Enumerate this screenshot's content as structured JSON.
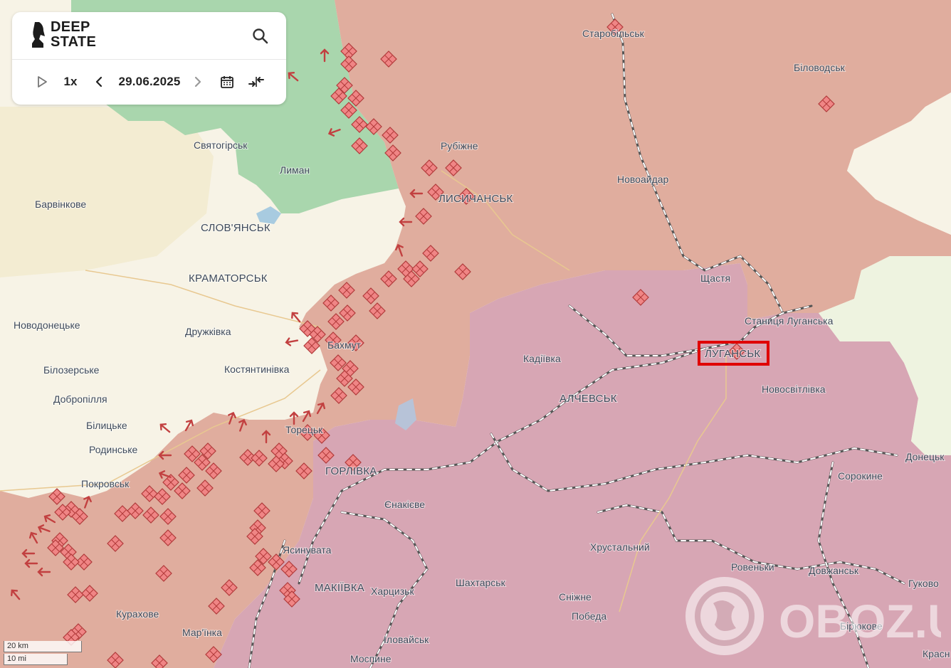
{
  "app": {
    "logo_line1": "DEEP",
    "logo_line2": "STATE",
    "speed": "1x",
    "date": "29.06.2025"
  },
  "icons": [
    "deepstate-knight-icon",
    "search-icon",
    "play-icon",
    "chevron-left-icon",
    "chevron-right-icon",
    "calendar-icon",
    "collapse-arrows-icon"
  ],
  "colors": {
    "occupied_long": "#d8a7b3",
    "occupied_recent": "#e0ad9e",
    "liberated": "#a7d6ad",
    "free": "#f7f3e6",
    "marker": "#f08080"
  },
  "scale": {
    "km": "20 km",
    "mi": "10 mi"
  },
  "watermark": "OBOZ.UA",
  "labels": [
    {
      "key": "starobilsk",
      "text": "Старобільськ",
      "type": "town"
    },
    {
      "key": "bilovodsk",
      "text": "Біловодськ",
      "type": "town"
    },
    {
      "key": "svyatohirsk",
      "text": "Святогірськ",
      "type": "town"
    },
    {
      "key": "rubizhne",
      "text": "Рубіжне",
      "type": "town"
    },
    {
      "key": "lyman",
      "text": "Лиман",
      "type": "town"
    },
    {
      "key": "novoaidar",
      "text": "Новоайдар",
      "type": "town"
    },
    {
      "key": "barvinkove",
      "text": "Барвінкове",
      "type": "town"
    },
    {
      "key": "lysychansk",
      "text": "ЛИСИЧАНСЬК",
      "type": "city"
    },
    {
      "key": "sloviansk",
      "text": "СЛОВ'ЯНСЬК",
      "type": "city"
    },
    {
      "key": "kramatorsk",
      "text": "КРАМАТОРСЬК",
      "type": "city"
    },
    {
      "key": "shchastia",
      "text": "Щастя",
      "type": "town"
    },
    {
      "key": "stanytsia",
      "text": "Станиця Луганська",
      "type": "town"
    },
    {
      "key": "novodonetske",
      "text": "Новодонецьке",
      "type": "town"
    },
    {
      "key": "druzhkivka",
      "text": "Дружківка",
      "type": "town"
    },
    {
      "key": "bakhmut",
      "text": "Бахмут",
      "type": "town"
    },
    {
      "key": "kadiivka",
      "text": "Кадіївка",
      "type": "town"
    },
    {
      "key": "luhansk",
      "text": "ЛУГАНСЬК",
      "type": "city"
    },
    {
      "key": "bilozerske",
      "text": "Білозерське",
      "type": "town"
    },
    {
      "key": "kostiantynivka",
      "text": "Костянтинівка",
      "type": "town"
    },
    {
      "key": "novosvitlivka",
      "text": "Новосвітлівка",
      "type": "town"
    },
    {
      "key": "dobropillia",
      "text": "Добропілля",
      "type": "town"
    },
    {
      "key": "alchevsk",
      "text": "АЛЧЕВСЬК",
      "type": "city"
    },
    {
      "key": "bilytske",
      "text": "Білицьке",
      "type": "town"
    },
    {
      "key": "toretsk",
      "text": "Торецьк",
      "type": "town"
    },
    {
      "key": "rodynske",
      "text": "Родинське",
      "type": "town"
    },
    {
      "key": "horlivka",
      "text": "ГОРЛІВКА",
      "type": "city"
    },
    {
      "key": "donetsk_town",
      "text": "Донецьк",
      "type": "town"
    },
    {
      "key": "sorokyne",
      "text": "Сорокине",
      "type": "town"
    },
    {
      "key": "pokrovsk",
      "text": "Покровськ",
      "type": "town"
    },
    {
      "key": "yenakiieve",
      "text": "Єнакієве",
      "type": "town"
    },
    {
      "key": "khrustalnyi",
      "text": "Хрустальний",
      "type": "town"
    },
    {
      "key": "yasynuvata",
      "text": "Ясинувата",
      "type": "town"
    },
    {
      "key": "rovenky",
      "text": "Ровеньки",
      "type": "town"
    },
    {
      "key": "dovzhansk",
      "text": "Довжанськ",
      "type": "town"
    },
    {
      "key": "makiivka",
      "text": "МАКІЇВКА",
      "type": "city"
    },
    {
      "key": "khartsyzk",
      "text": "Харцизьк",
      "type": "town"
    },
    {
      "key": "shakhtarsk",
      "text": "Шахтарськ",
      "type": "town"
    },
    {
      "key": "hukovo",
      "text": "Гуково",
      "type": "town"
    },
    {
      "key": "snizhne",
      "text": "Сніжне",
      "type": "town"
    },
    {
      "key": "kurakhove",
      "text": "Курахове",
      "type": "town"
    },
    {
      "key": "pobeda",
      "text": "Победа",
      "type": "town"
    },
    {
      "key": "marinka",
      "text": "Мар'їнка",
      "type": "town"
    },
    {
      "key": "ilovaisk",
      "text": "Іловайськ",
      "type": "town"
    },
    {
      "key": "biriukove",
      "text": "Бірюкове",
      "type": "town"
    },
    {
      "key": "mospyne",
      "text": "Моспине",
      "type": "town"
    },
    {
      "key": "krasnyi",
      "text": "Красн",
      "type": "town"
    }
  ]
}
